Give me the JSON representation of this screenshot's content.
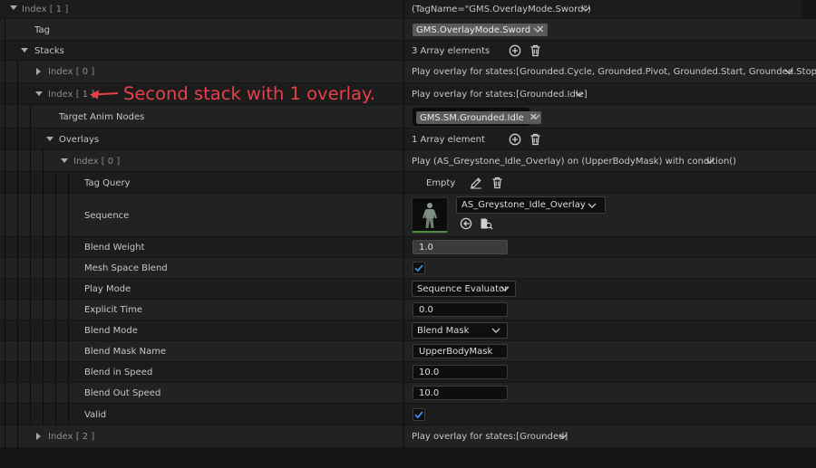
{
  "colors": {
    "accent": "#3b8be0",
    "annotation": "#e8404a"
  },
  "rows": {
    "index1_top": {
      "label": "Index [ 1 ]",
      "value": "(TagName=\"GMS.OverlayMode.Sword\")"
    },
    "tag": {
      "label": "Tag",
      "chip": "GMS.OverlayMode.Sword"
    },
    "stacks": {
      "label": "Stacks",
      "value": "3 Array elements"
    },
    "stack0": {
      "label": "Index [ 0 ]",
      "value": "Play overlay for states:[Grounded.Cycle, Grounded.Pivot, Grounded.Start, Grounded.Stop, InA"
    },
    "stack1": {
      "label": "Index [ 1 ]",
      "value": "Play overlay for states:[Grounded.Idle]"
    },
    "target_anim_nodes": {
      "label": "Target Anim Nodes",
      "chip": "GMS.SM.Grounded.Idle"
    },
    "overlays": {
      "label": "Overlays",
      "value": "1 Array element"
    },
    "overlay0": {
      "label": "Index [ 0 ]",
      "value": "Play (AS_Greystone_Idle_Overlay) on (UpperBodyMask) with condition()"
    },
    "tag_query": {
      "label": "Tag Query",
      "value": "Empty"
    },
    "sequence": {
      "label": "Sequence",
      "asset": "AS_Greystone_Idle_Overlay"
    },
    "blend_weight": {
      "label": "Blend Weight",
      "value": "1.0"
    },
    "mesh_space_blend": {
      "label": "Mesh Space Blend",
      "checked": true
    },
    "play_mode": {
      "label": "Play Mode",
      "value": "Sequence Evaluator"
    },
    "explicit_time": {
      "label": "Explicit Time",
      "value": "0.0"
    },
    "blend_mode": {
      "label": "Blend Mode",
      "value": "Blend Mask"
    },
    "blend_mask_name": {
      "label": "Blend Mask Name",
      "value": "UpperBodyMask"
    },
    "blend_in_speed": {
      "label": "Blend in Speed",
      "value": "10.0"
    },
    "blend_out_speed": {
      "label": "Blend Out Speed",
      "value": "10.0"
    },
    "valid": {
      "label": "Valid",
      "checked": true
    },
    "stack2": {
      "label": "Index [ 2 ]",
      "value": "Play overlay for states:[Grounded]"
    }
  },
  "annotation": {
    "text": "Second stack with 1 overlay."
  },
  "icons": {
    "expanded": "caret-down-icon",
    "collapsed": "caret-right-icon",
    "dropdown": "chevron-down-icon",
    "add": "plus-circle-icon",
    "delete": "trash-icon",
    "edit": "pencil-icon",
    "clear": "close-icon",
    "browse": "browse-asset-icon",
    "use": "use-selected-icon"
  }
}
